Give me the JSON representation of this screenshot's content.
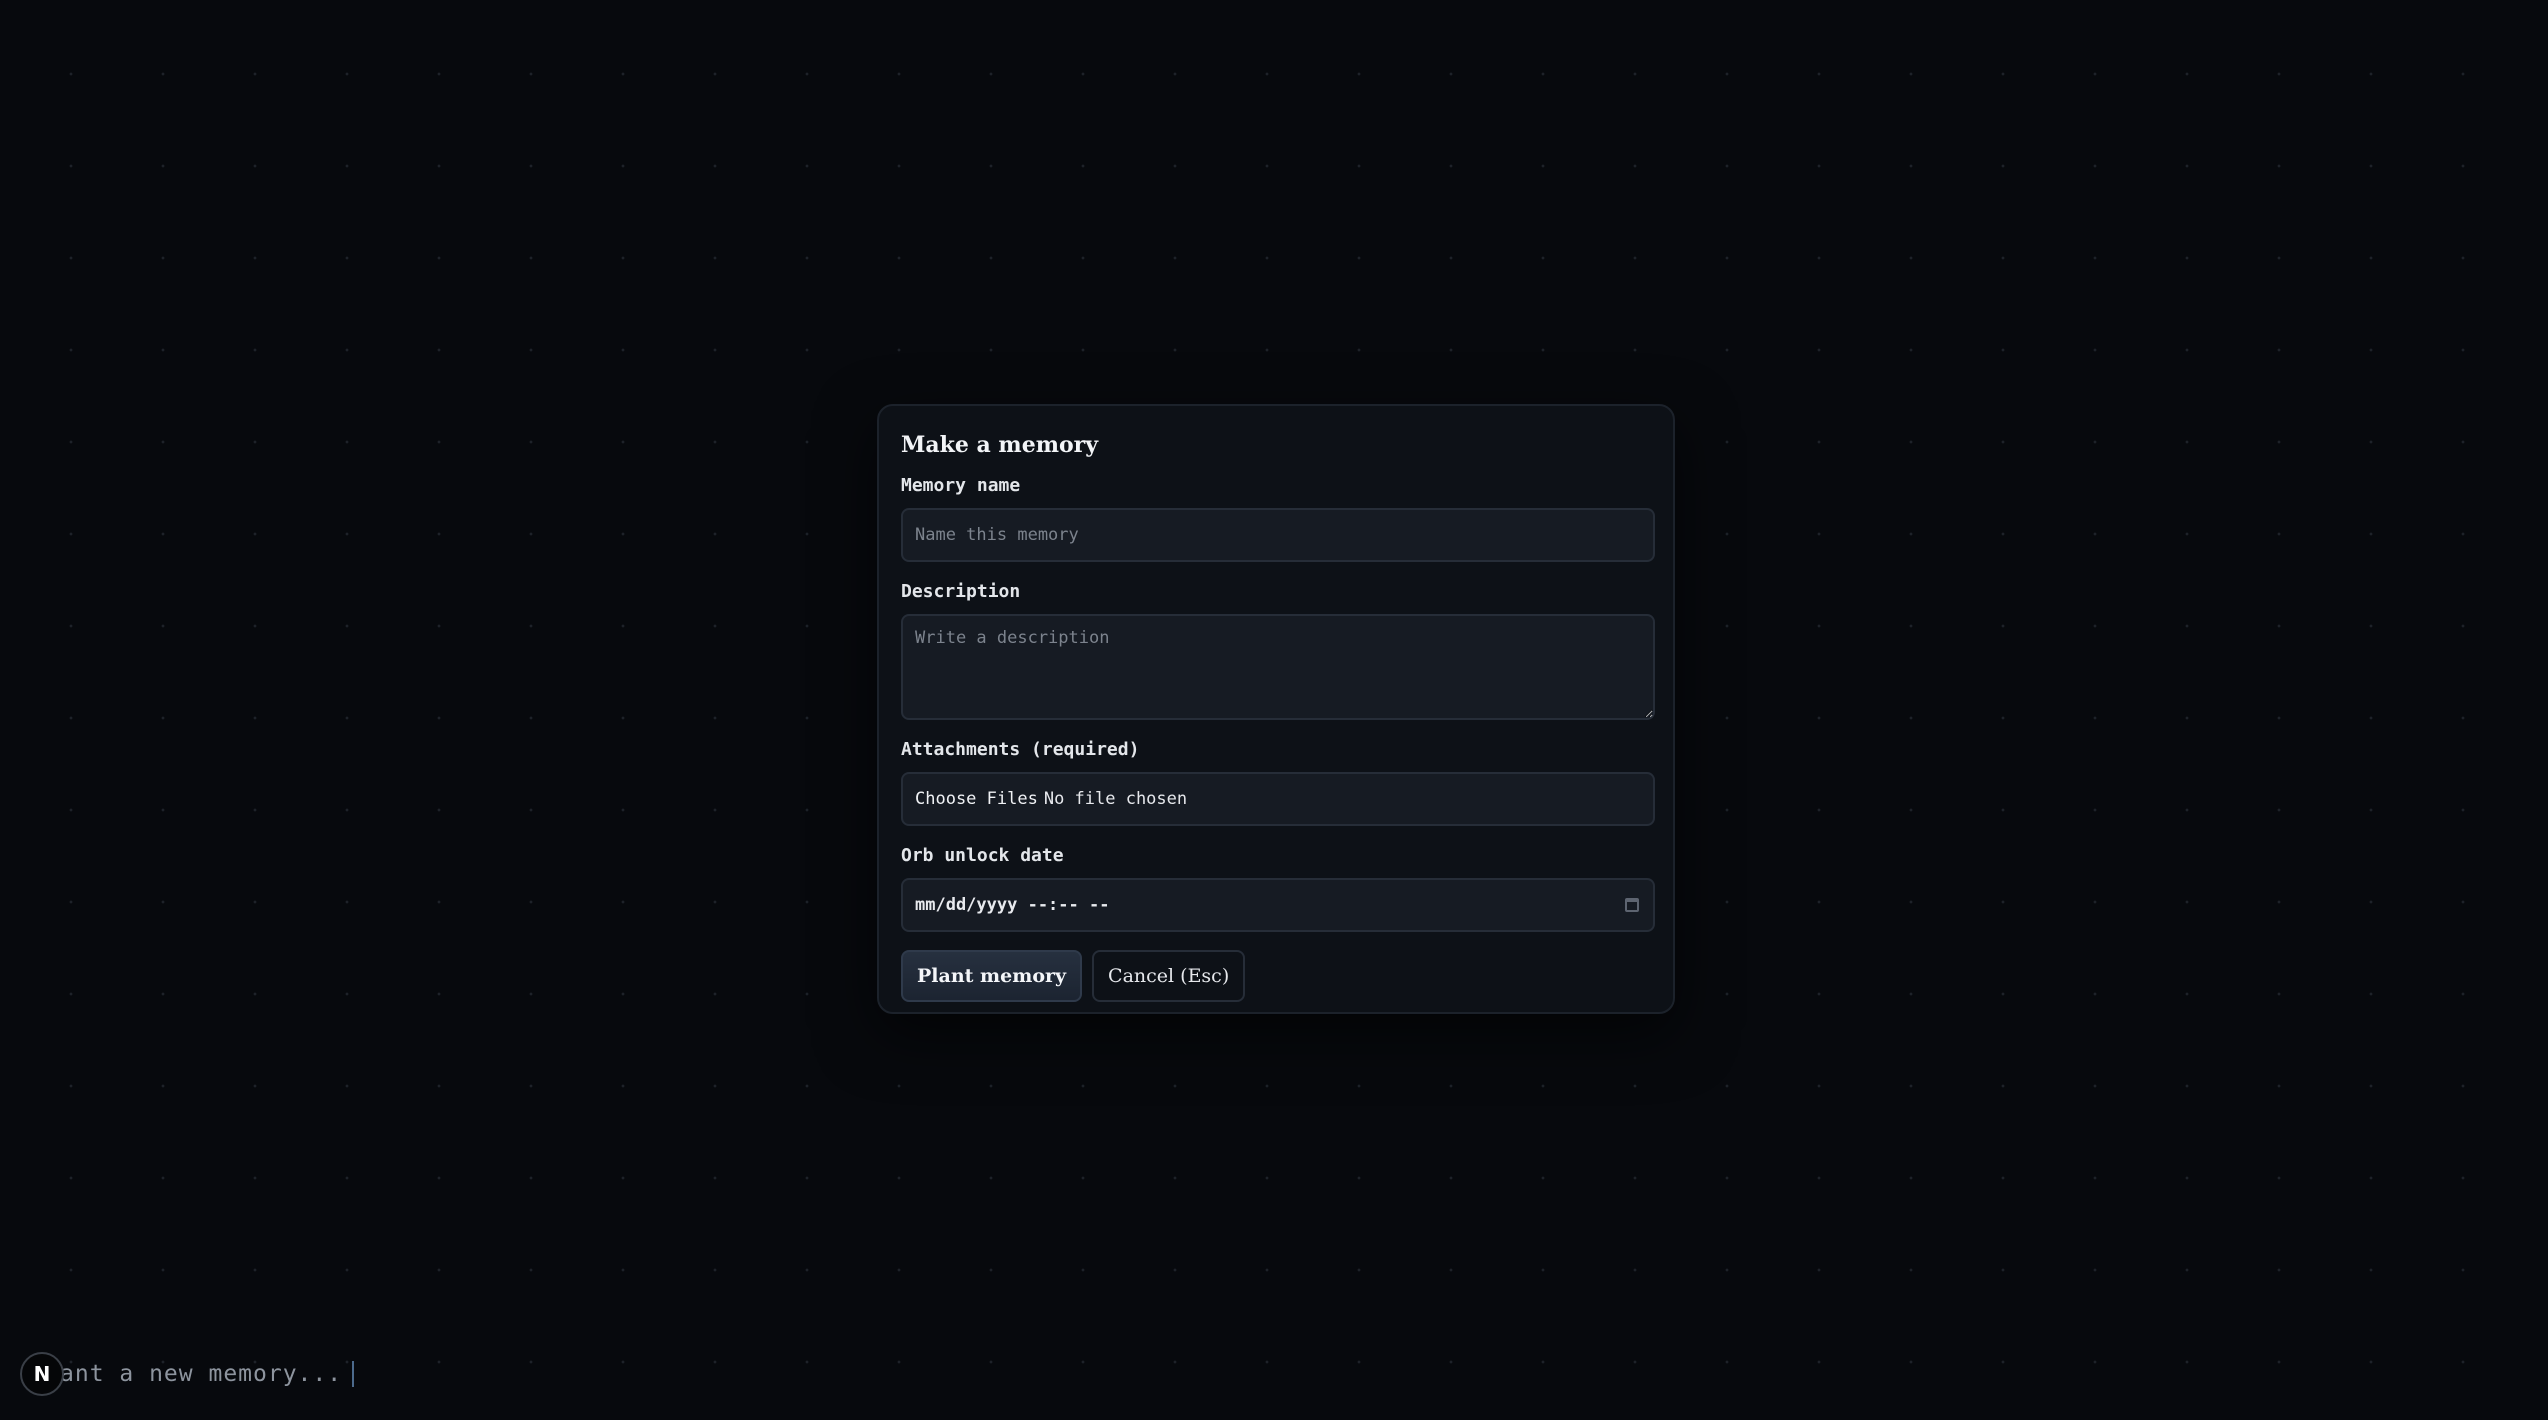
{
  "modal": {
    "title": "Make a memory",
    "name_label": "Memory name",
    "name_placeholder": "Name this memory",
    "description_label": "Description",
    "description_placeholder": "Write a description",
    "attachments_label": "Attachments (required)",
    "choose_files_label": "Choose Files",
    "file_status": "No file chosen",
    "unlock_label": "Orb unlock date",
    "unlock_value": "mm/dd/yyyy --:-- --",
    "plant_button": "Plant memory",
    "cancel_button": "Cancel (Esc)"
  },
  "bottom_bar": {
    "badge": "N",
    "prompt": "ant a new memory..."
  },
  "colors": {
    "background": "#07090d",
    "panel": "#0d1117",
    "input": "#161b23",
    "accent_button": "#26303f"
  }
}
